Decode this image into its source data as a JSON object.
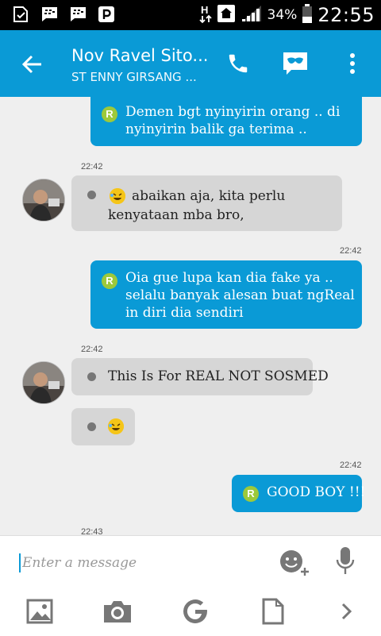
{
  "status_bar": {
    "battery": "34%",
    "time": "22:55",
    "icons": [
      "screenshot-icon",
      "bbm-icon",
      "bbm-icon",
      "pinterest-icon",
      "data-transfer-icon",
      "home-network-icon",
      "signal-icon",
      "battery-icon"
    ]
  },
  "header": {
    "title": "Nov Ravel Sito...",
    "subtitle": "ST ENNY GIRSANG ..."
  },
  "messages": [
    {
      "direction": "out",
      "lines": [
        "Demen bgt nyinyirin orang .. di",
        "nyinyirin balik ga terima .."
      ]
    },
    {
      "direction": "in",
      "time": "22:42",
      "lines": [
        "abaikan aja, kita perlu",
        "kenyataan mba bro,"
      ]
    },
    {
      "direction": "out",
      "time": "22:42",
      "lines": [
        "Oia gue lupa kan dia fake ya ..",
        "selalu banyak alesan buat ngReal",
        "in diri dia sendiri"
      ]
    },
    {
      "direction": "in",
      "time": "22:42",
      "lines": [
        "This Is For REAL NOT SOSMED"
      ]
    },
    {
      "direction": "in",
      "lines": [
        ""
      ]
    },
    {
      "direction": "out",
      "time": "22:42",
      "lines": [
        "GOOD BOY !!!"
      ]
    },
    {
      "direction": "in",
      "time": "22:43",
      "lines": []
    }
  ],
  "badge_letter": "R",
  "composer": {
    "placeholder": "Enter a message"
  },
  "colors": {
    "accent": "#0a9ad6",
    "incoming_bubble": "#d6d6d6",
    "badge": "#9dc93b"
  }
}
